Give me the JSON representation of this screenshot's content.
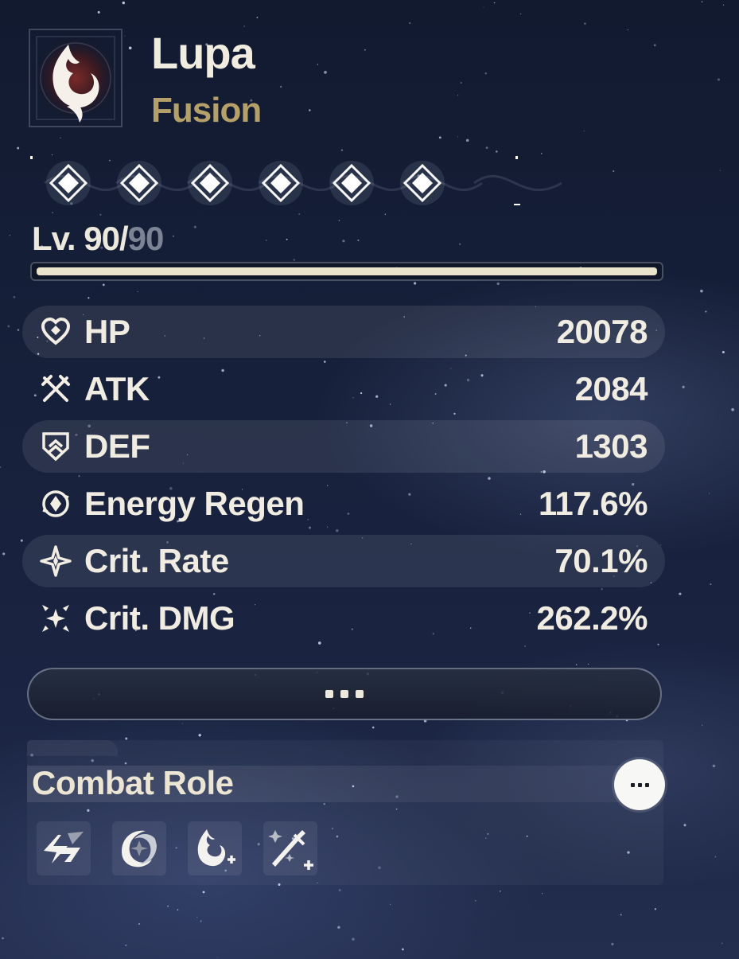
{
  "character": {
    "name": "Lupa",
    "element": "Fusion",
    "emblem_icon": "fusion-flame-icon"
  },
  "resonance_nodes": {
    "count": 6,
    "icon": "diamond-node-icon"
  },
  "level": {
    "prefix": "Lv. ",
    "current": "90",
    "separator": "/",
    "max": "90",
    "progress": 1.0
  },
  "stats": [
    {
      "icon": "hp-heart-icon",
      "label": "HP",
      "value": "20078"
    },
    {
      "icon": "atk-crossed-swords-icon",
      "label": "ATK",
      "value": "2084"
    },
    {
      "icon": "def-shield-icon",
      "label": "DEF",
      "value": "1303"
    },
    {
      "icon": "energy-regen-icon",
      "label": "Energy Regen",
      "value": "117.6%"
    },
    {
      "icon": "crit-rate-star-icon",
      "label": "Crit. Rate",
      "value": "70.1%"
    },
    {
      "icon": "crit-dmg-burst-icon",
      "label": "Crit. DMG",
      "value": "262.2%"
    }
  ],
  "more_stats_button": {
    "icon": "more-dots-icon"
  },
  "combat_role": {
    "title": "Combat Role",
    "more_icon": "more-dots-icon",
    "roles": [
      {
        "icon": "lightning-strike-role-icon"
      },
      {
        "icon": "vortex-star-role-icon"
      },
      {
        "icon": "fusion-plus-role-icon"
      },
      {
        "icon": "sword-plus-role-icon"
      }
    ]
  },
  "colors": {
    "element": "#b5a06a",
    "text": "#f0ece2",
    "level_max": "#7b8494",
    "xp_fill": "#ebe4cc"
  }
}
